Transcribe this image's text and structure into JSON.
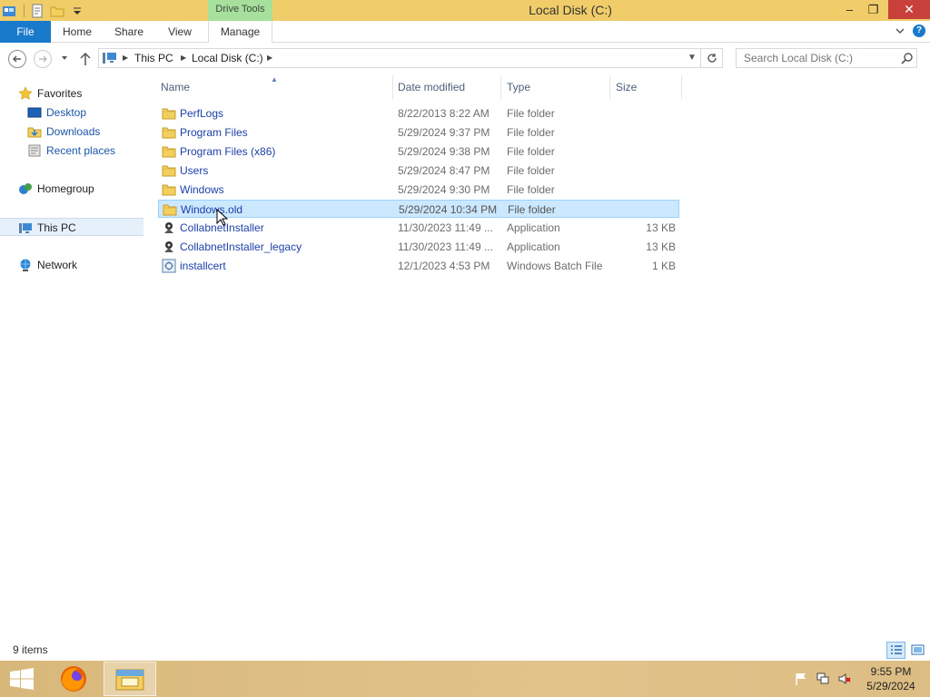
{
  "window": {
    "title": "Local Disk (C:)",
    "contextual_tab": "Drive Tools",
    "controls": {
      "minimize": "‒",
      "maximize": "❐",
      "close": "✕"
    }
  },
  "ribbon": {
    "tabs": [
      "File",
      "Home",
      "Share",
      "View",
      "Manage"
    ],
    "help": "?"
  },
  "address_bar": {
    "crumbs": [
      "This PC",
      "Local Disk (C:)"
    ],
    "search_placeholder": "Search Local Disk (C:)"
  },
  "nav_pane": {
    "favorites": "Favorites",
    "favorites_items": [
      "Desktop",
      "Downloads",
      "Recent places"
    ],
    "homegroup": "Homegroup",
    "this_pc": "This PC",
    "network": "Network"
  },
  "columns": {
    "name": "Name",
    "date": "Date modified",
    "type": "Type",
    "size": "Size"
  },
  "files": [
    {
      "name": "PerfLogs",
      "date": "8/22/2013 8:22 AM",
      "type": "File folder",
      "size": "",
      "icon": "folder-icon"
    },
    {
      "name": "Program Files",
      "date": "5/29/2024 9:37 PM",
      "type": "File folder",
      "size": "",
      "icon": "folder-icon"
    },
    {
      "name": "Program Files (x86)",
      "date": "5/29/2024 9:38 PM",
      "type": "File folder",
      "size": "",
      "icon": "folder-icon"
    },
    {
      "name": "Users",
      "date": "5/29/2024 8:47 PM",
      "type": "File folder",
      "size": "",
      "icon": "folder-icon"
    },
    {
      "name": "Windows",
      "date": "5/29/2024 9:30 PM",
      "type": "File folder",
      "size": "",
      "icon": "folder-icon"
    },
    {
      "name": "Windows.old",
      "date": "5/29/2024 10:34 PM",
      "type": "File folder",
      "size": "",
      "icon": "folder-icon",
      "selected": true
    },
    {
      "name": "CollabnetInstaller",
      "date": "11/30/2023 11:49 ...",
      "type": "Application",
      "size": "13 KB",
      "icon": "application-icon"
    },
    {
      "name": "CollabnetInstaller_legacy",
      "date": "11/30/2023 11:49 ...",
      "type": "Application",
      "size": "13 KB",
      "icon": "application-icon"
    },
    {
      "name": "installcert",
      "date": "12/1/2023 4:53 PM",
      "type": "Windows Batch File",
      "size": "1 KB",
      "icon": "batch-file-icon"
    }
  ],
  "status": {
    "item_count": "9 items"
  },
  "taskbar": {
    "time": "9:55 PM",
    "date": "5/29/2024"
  },
  "colors": {
    "file_tab": "#1979ca",
    "title_bar": "#f1cd6a",
    "drive_tools": "#a7df9d",
    "selection": "#cce8ff",
    "close": "#c7403a"
  }
}
